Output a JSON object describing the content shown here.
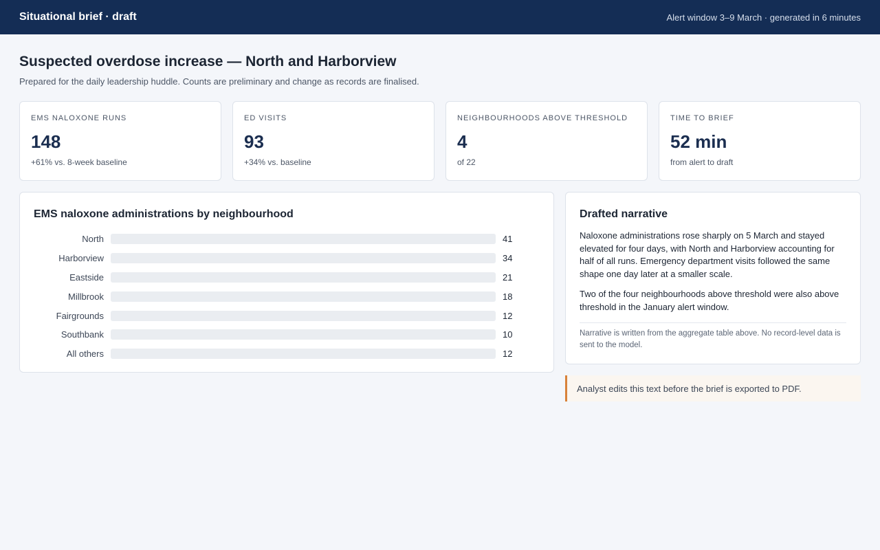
{
  "header": {
    "title": "Situational brief · draft",
    "window_info": "Alert window 3–9 March · generated in 6 minutes"
  },
  "page": {
    "title": "Suspected overdose increase — North and Harborview",
    "subtitle": "Prepared for the daily leadership huddle. Counts are preliminary and change as records are finalised."
  },
  "kpis": [
    {
      "label": "EMS naloxone runs",
      "value": "148",
      "note": "+61% vs. 8-week baseline"
    },
    {
      "label": "ED visits",
      "value": "93",
      "note": "+34% vs. baseline"
    },
    {
      "label": "Neighbourhoods above threshold",
      "value": "4",
      "note": "of 22"
    },
    {
      "label": "Time to brief",
      "value": "52 min",
      "note": "from alert to draft"
    }
  ],
  "chart_card": {
    "title": "EMS naloxone administrations by neighbourhood"
  },
  "chart_data": {
    "type": "bar",
    "orientation": "horizontal",
    "title": "EMS naloxone administrations by neighbourhood",
    "categories": [
      "North",
      "Harborview",
      "Eastside",
      "Millbrook",
      "Fairgrounds",
      "Southbank",
      "All others"
    ],
    "values": [
      41,
      34,
      21,
      18,
      12,
      10,
      12
    ],
    "xlim": [
      0,
      41
    ]
  },
  "narrative": {
    "title": "Drafted narrative",
    "paragraph1": "Naloxone administrations rose sharply on 5 March and stayed elevated for four days, with North and Harborview accounting for half of all runs. Emergency department visits followed the same shape one day later at a smaller scale.",
    "paragraph2": "Two of the four neighbourhoods above threshold were also above threshold in the January alert window.",
    "footnote": "Narrative is written from the aggregate table above. No record-level data is sent to the model."
  },
  "edit_note": "Analyst edits this text before the brief is exported to PDF.",
  "colors": {
    "header_bg": "#142d55",
    "bar_track": "#eaedf1",
    "bar_fill": "#eaedf1",
    "edit_note_accent": "#d8823a"
  }
}
